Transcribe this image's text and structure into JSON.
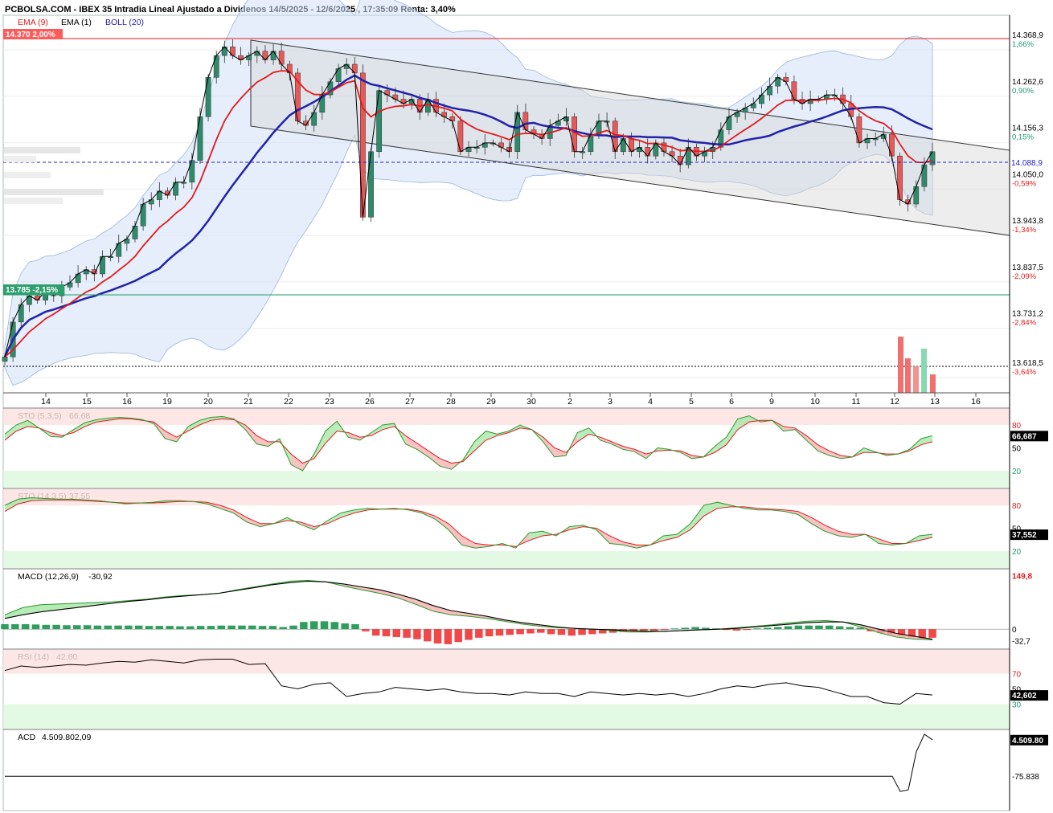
{
  "header": {
    "title": "PCBOLSA.COM - IBEX 35 Intradia Lineal Ajustado a Dividenos 14/5/2025 - 12/6/2025 , 17:35:09 Renta: 3,40%",
    "legend": [
      {
        "label": "EMA (9)",
        "color": "#e31a1c"
      },
      {
        "label": "EMA (1)",
        "color": "#000000"
      },
      {
        "label": "BOLL (20)",
        "color": "#2222aa"
      }
    ]
  },
  "chart_data": [
    {
      "type": "candlestick",
      "panel": "price",
      "x_ticks": [
        "14",
        "15",
        "16",
        "19",
        "20",
        "21",
        "22",
        "23",
        "26",
        "27",
        "28",
        "29",
        "30",
        "2",
        "3",
        "4",
        "5",
        "6",
        "9",
        "10",
        "11",
        "12",
        "13",
        "16"
      ],
      "y_ticks": [
        {
          "value": "14.368,9",
          "pct": "1,66%"
        },
        {
          "value": "14.262,6",
          "pct": "0,90%"
        },
        {
          "value": "14.156,3",
          "pct": "0,15%"
        },
        {
          "value": "14.050,0",
          "pct": "-0,59%"
        },
        {
          "value": "13.943,8",
          "pct": "-1,34%"
        },
        {
          "value": "13.837,5",
          "pct": "-2,09%"
        },
        {
          "value": "13.731,2",
          "pct": "-2,84%"
        },
        {
          "value": "13.618,5",
          "pct": "-3,64%"
        }
      ],
      "ylim": [
        13600,
        14410
      ],
      "levels": [
        {
          "label": "14.370 2,00%",
          "value": 14370,
          "color": "#e31a1c"
        },
        {
          "label": "13.785 -2,15%",
          "value": 13785,
          "color": "#1a9a6a"
        },
        {
          "label": "14.088,9",
          "value": 14088.9,
          "color": "#2222aa"
        },
        {
          "label": "",
          "value": 13618.5,
          "color": "#000000"
        }
      ],
      "series": [
        {
          "name": "Close",
          "values": [
            13640,
            13720,
            13760,
            13780,
            13770,
            13790,
            13780,
            13800,
            13810,
            13830,
            13840,
            13830,
            13870,
            13870,
            13900,
            13910,
            13940,
            13990,
            14000,
            14020,
            14010,
            14040,
            14040,
            14090,
            14190,
            14280,
            14330,
            14350,
            14330,
            14320,
            14330,
            14340,
            14320,
            14340,
            14310,
            14290,
            14180,
            14170,
            14200,
            14240,
            14270,
            14300,
            14310,
            14290,
            13960,
            14110,
            14250,
            14240,
            14230,
            14220,
            14230,
            14200,
            14230,
            14200,
            14190,
            14180,
            14110,
            14120,
            14120,
            14130,
            14130,
            14120,
            14110,
            14200,
            14160,
            14150,
            14140,
            14170,
            14180,
            14190,
            14110,
            14110,
            14150,
            14180,
            14180,
            14110,
            14140,
            14110,
            14120,
            14100,
            14130,
            14110,
            14100,
            14080,
            14120,
            14100,
            14110,
            14120,
            14160,
            14190,
            14200,
            14210,
            14220,
            14240,
            14260,
            14280,
            14270,
            14230,
            14220,
            14230,
            14230,
            14240,
            14240,
            14220,
            14190,
            14130,
            14140,
            14140,
            14150,
            14100,
            14000,
            13990,
            14030,
            14080,
            14110
          ]
        }
      ],
      "bollinger": {
        "upper_max": 14330,
        "lower_min": 13720,
        "period": 20
      }
    },
    {
      "type": "line",
      "panel": "STO (5,3,5)",
      "title": "STO (5,3,5)",
      "value": "66,68",
      "last": "66,687",
      "y_ticks": [
        "80",
        "50",
        "20"
      ],
      "ylim": [
        0,
        100
      ],
      "series": [
        {
          "values": [
            68,
            80,
            86,
            76,
            65,
            64,
            74,
            83,
            87,
            89,
            90,
            89,
            87,
            82,
            62,
            58,
            78,
            86,
            90,
            91,
            88,
            74,
            55,
            52,
            62,
            28,
            20,
            42,
            72,
            85,
            64,
            60,
            70,
            80,
            82,
            55,
            48,
            38,
            26,
            22,
            34,
            58,
            72,
            68,
            72,
            80,
            74,
            58,
            38,
            40,
            70,
            76,
            60,
            55,
            48,
            45,
            36,
            50,
            48,
            44,
            36,
            38,
            52,
            64,
            88,
            92,
            84,
            86,
            72,
            74,
            60,
            46,
            40,
            36,
            38,
            50,
            45,
            40,
            42,
            48,
            62,
            66
          ]
        },
        {
          "values": [
            60,
            72,
            78,
            76,
            70,
            66,
            70,
            78,
            84,
            86,
            88,
            88,
            86,
            84,
            72,
            64,
            72,
            80,
            86,
            88,
            87,
            80,
            66,
            58,
            58,
            42,
            30,
            36,
            56,
            72,
            70,
            64,
            66,
            74,
            78,
            66,
            56,
            46,
            36,
            30,
            32,
            46,
            60,
            66,
            70,
            76,
            74,
            64,
            50,
            44,
            58,
            68,
            64,
            58,
            52,
            48,
            42,
            46,
            47,
            46,
            40,
            38,
            44,
            54,
            74,
            84,
            86,
            86,
            78,
            76,
            66,
            54,
            46,
            40,
            38,
            44,
            44,
            42,
            42,
            46,
            54,
            58
          ]
        }
      ]
    },
    {
      "type": "line",
      "panel": "STO (14,3,5)",
      "title": "STO (14,3,5)",
      "value": "37,55",
      "last": "37,552",
      "y_ticks": [
        "80",
        "50",
        "20"
      ],
      "ylim": [
        0,
        100
      ],
      "series": [
        {
          "values": [
            80,
            88,
            90,
            89,
            88,
            88,
            87,
            86,
            84,
            82,
            83,
            84,
            86,
            86,
            85,
            82,
            76,
            70,
            58,
            52,
            56,
            64,
            55,
            48,
            60,
            70,
            74,
            76,
            75,
            76,
            74,
            70,
            62,
            48,
            28,
            24,
            26,
            30,
            24,
            44,
            46,
            40,
            52,
            54,
            48,
            30,
            28,
            24,
            28,
            40,
            42,
            56,
            80,
            84,
            80,
            76,
            74,
            74,
            72,
            68,
            56,
            46,
            40,
            38,
            42,
            30,
            28,
            30,
            40,
            42
          ]
        },
        {
          "values": [
            72,
            82,
            86,
            87,
            87,
            87,
            86,
            85,
            84,
            83,
            83,
            83,
            84,
            85,
            85,
            84,
            80,
            74,
            64,
            56,
            56,
            60,
            58,
            52,
            56,
            64,
            70,
            74,
            75,
            75,
            75,
            72,
            66,
            56,
            40,
            30,
            28,
            28,
            26,
            34,
            40,
            42,
            48,
            52,
            50,
            40,
            32,
            28,
            28,
            34,
            38,
            48,
            66,
            76,
            78,
            78,
            76,
            75,
            74,
            72,
            64,
            54,
            46,
            42,
            42,
            36,
            30,
            30,
            34,
            38
          ]
        }
      ]
    },
    {
      "type": "line",
      "panel": "MACD (12,26,9)",
      "title": "MACD (12,26,9)",
      "value": "-30,92",
      "y_ticks": [
        "149,8",
        "0",
        "-32,7"
      ],
      "ylim": [
        -40,
        155
      ],
      "series": [
        {
          "name": "MACD",
          "values": [
            40,
            60,
            68,
            70,
            72,
            74,
            76,
            80,
            84,
            90,
            94,
            96,
            100,
            110,
            118,
            126,
            134,
            136,
            132,
            120,
            110,
            100,
            88,
            70,
            50,
            40,
            36,
            30,
            22,
            14,
            8,
            4,
            2,
            0,
            -4,
            -8,
            -8,
            -6,
            -4,
            -2,
            0,
            4,
            8,
            12,
            18,
            22,
            24,
            20,
            6,
            -10,
            -22,
            -28,
            -30
          ]
        },
        {
          "name": "Signal",
          "values": [
            30,
            40,
            48,
            54,
            60,
            66,
            72,
            78,
            82,
            88,
            92,
            96,
            100,
            108,
            116,
            124,
            130,
            134,
            132,
            126,
            118,
            110,
            98,
            84,
            66,
            52,
            44,
            36,
            26,
            18,
            12,
            6,
            2,
            0,
            -2,
            -4,
            -6,
            -6,
            -4,
            -2,
            0,
            2,
            6,
            10,
            14,
            18,
            20,
            20,
            12,
            0,
            -12,
            -20,
            -28
          ]
        }
      ],
      "histogram": [
        14,
        14,
        14,
        13,
        12,
        12,
        11,
        11,
        11,
        10,
        10,
        10,
        10,
        10,
        9,
        9,
        9,
        8,
        8,
        9,
        9,
        10,
        10,
        10,
        10,
        9,
        9,
        6,
        10,
        20,
        22,
        22,
        20,
        16,
        14,
        -6,
        -18,
        -20,
        -22,
        -24,
        -28,
        -34,
        -40,
        -42,
        -36,
        -30,
        -24,
        -20,
        -18,
        -16,
        -14,
        -12,
        -10,
        -14,
        -16,
        -18,
        -16,
        -14,
        -12,
        -10,
        -8,
        -6,
        -4,
        -4,
        -2,
        2,
        4,
        6,
        4,
        2,
        -2,
        -4,
        -2,
        2,
        4,
        6,
        8,
        10,
        10,
        10,
        10,
        8,
        6,
        4,
        -6,
        -10,
        -14,
        -18,
        -22,
        -26,
        -24
      ]
    },
    {
      "type": "line",
      "panel": "RSI (14)",
      "title": "RSI (14)",
      "value": "42,60",
      "last": "42,602",
      "y_ticks": [
        "70",
        "50",
        "30"
      ],
      "ylim": [
        0,
        100
      ],
      "series": [
        {
          "values": [
            74,
            80,
            78,
            80,
            82,
            81,
            84,
            86,
            85,
            88,
            86,
            84,
            88,
            89,
            89,
            82,
            83,
            54,
            50,
            56,
            58,
            40,
            44,
            46,
            52,
            50,
            48,
            50,
            46,
            44,
            44,
            42,
            46,
            44,
            44,
            40,
            46,
            44,
            42,
            44,
            42,
            44,
            40,
            44,
            50,
            54,
            52,
            56,
            58,
            54,
            52,
            46,
            40,
            40,
            32,
            30,
            44,
            42
          ]
        }
      ]
    },
    {
      "type": "line",
      "panel": "ACD",
      "title": "ACD",
      "value": "4.509.802,09",
      "last": "4.509.80",
      "y_ticks": [
        "-75.838"
      ],
      "series": [
        {
          "values": [
            -75838,
            -75838,
            -75838,
            -75838,
            -75838,
            -75838,
            -75838,
            -75838,
            -75838,
            -75838,
            -75838,
            -75838,
            -2000000,
            -1800000,
            3000000,
            5200000,
            4509802
          ]
        }
      ]
    }
  ]
}
